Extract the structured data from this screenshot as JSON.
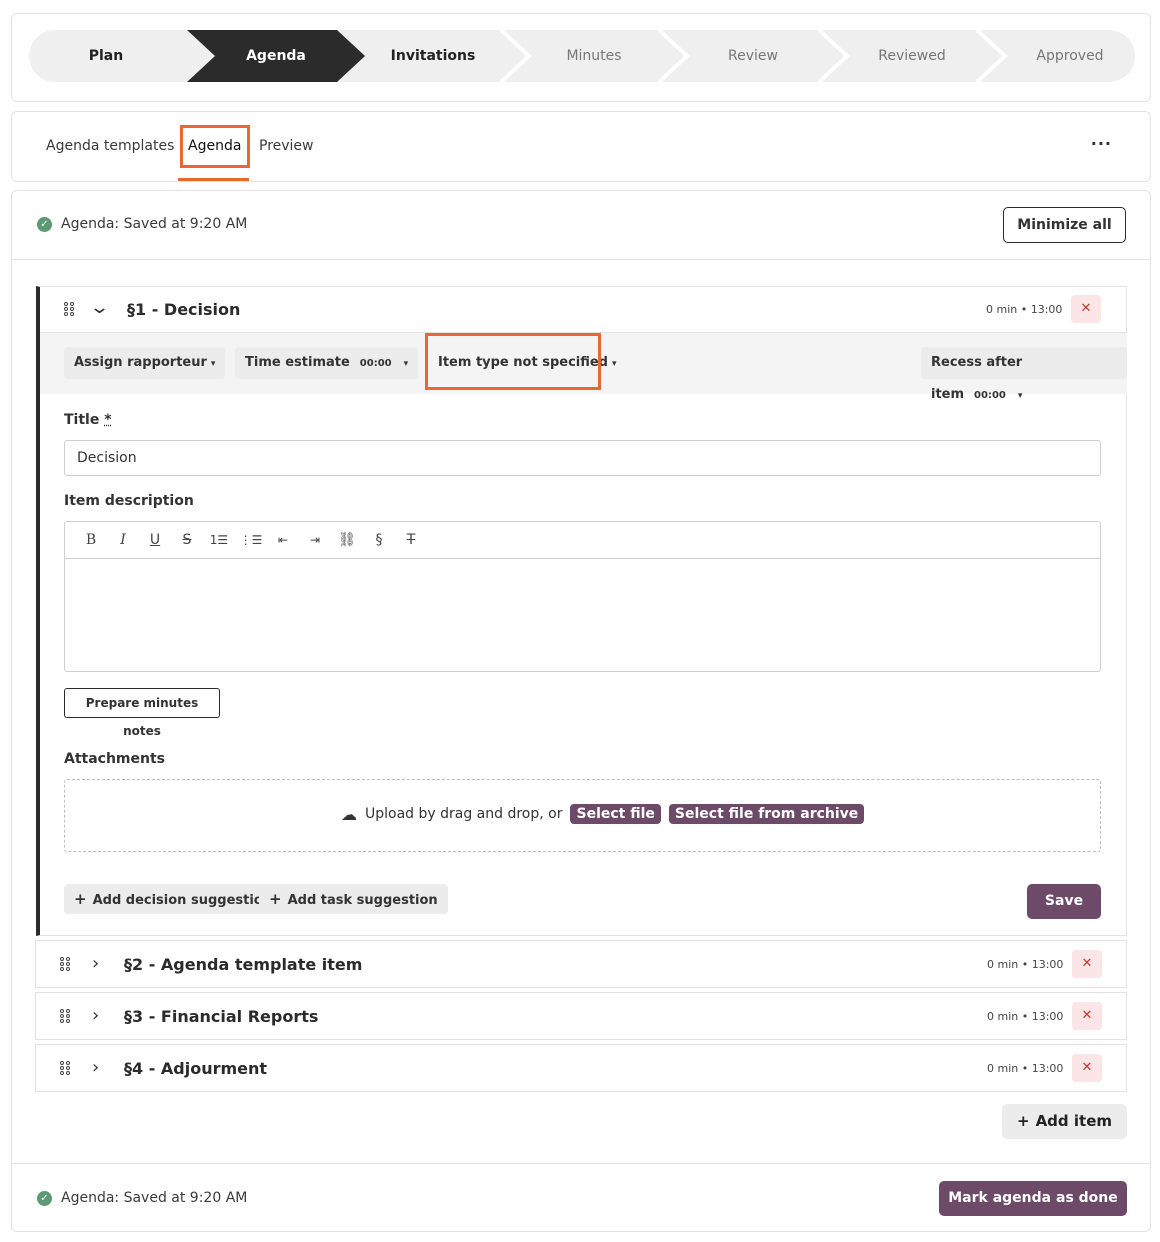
{
  "stepper": {
    "steps": [
      "Plan",
      "Agenda",
      "Invitations",
      "Minutes",
      "Review",
      "Reviewed",
      "Approved"
    ],
    "active_index": 1,
    "colors": {
      "active_bg": "#2b2b2b",
      "inactive_bg": "#efefef",
      "done_text": "#222222",
      "future_text": "#777777"
    }
  },
  "tabs": {
    "items": [
      "Agenda templates",
      "Agenda",
      "Preview"
    ],
    "active": "Agenda",
    "more_label": "···"
  },
  "status": {
    "top": "Agenda: Saved at 9:20 AM",
    "bottom": "Agenda: Saved at 9:20 AM"
  },
  "buttons": {
    "minimize_all": "Minimize all",
    "prepare_minutes": "Prepare minutes notes",
    "add_decision": "Add decision suggestion",
    "add_task": "Add task suggestion",
    "save": "Save",
    "add_item": "Add item",
    "mark_done": "Mark agenda as done"
  },
  "item1": {
    "title": "§1 - Decision",
    "meta": "0 min • 13:00",
    "toolbar": {
      "rapporteur": "Assign rapporteur",
      "time_estimate": "Time estimate",
      "time_estimate_value": "00:00",
      "item_type": "Item type not specified",
      "recess": "Recess after item",
      "recess_value": "00:00"
    },
    "title_label": "Title",
    "required_mark": "*",
    "title_value": "Decision",
    "description_label": "Item description",
    "attachments_label": "Attachments",
    "upload_text": "Upload by drag and drop, or",
    "select_file": "Select file",
    "select_archive": "Select file from archive"
  },
  "editor_tools": [
    "bold-icon",
    "italic-icon",
    "underline-icon",
    "strikethrough-icon",
    "ordered-list-icon",
    "bullet-list-icon",
    "outdent-icon",
    "indent-icon",
    "link-icon",
    "section-icon",
    "clear-format-icon"
  ],
  "collapsed_items": [
    {
      "title": "§2 - Agenda template item",
      "meta": "0 min • 13:00"
    },
    {
      "title": "§3 - Financial Reports",
      "meta": "0 min • 13:00"
    },
    {
      "title": "§4 - Adjourment",
      "meta": "0 min • 13:00"
    }
  ],
  "colors": {
    "accent": "#6d4b68",
    "highlight": "#e8692f",
    "success": "#5b9a72",
    "danger_bg": "#fbe5e6"
  }
}
